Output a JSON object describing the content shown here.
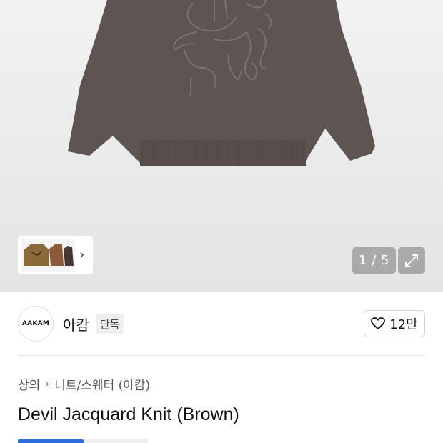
{
  "gallery": {
    "pager_text": "1 / 5",
    "thumb_icons": [
      "sweater-thumbnail-1",
      "sweater-thumbnail-2",
      "sweater-thumbnail-3"
    ]
  },
  "brand": {
    "logo_text": "AAKAM",
    "name": "아캄",
    "badge": "단독",
    "like_count": "12만"
  },
  "breadcrumb": {
    "category": "상의",
    "subcategory": "니트/스웨터 (아캄)"
  },
  "product": {
    "title": "Devil Jacquard Knit (Brown)"
  },
  "colors": {
    "accent": "#2b6ddc",
    "sweater": "#5e5452"
  }
}
